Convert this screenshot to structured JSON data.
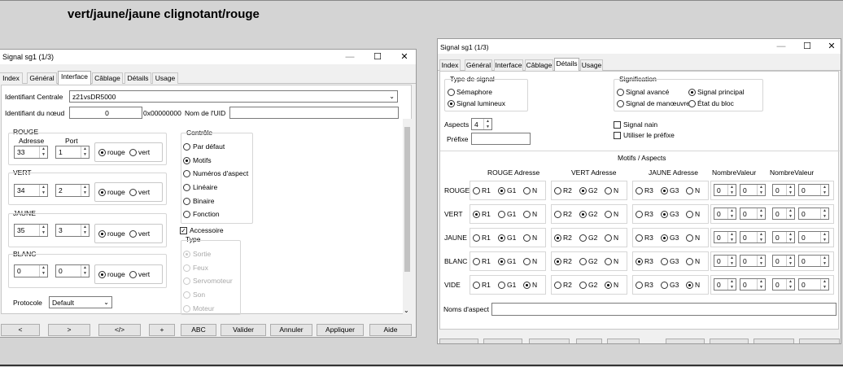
{
  "heading": "vert/jaune/jaune clignotant/rouge",
  "left": {
    "title": "Signal sg1 (1/3)",
    "window_buttons": [
      "—",
      "☐",
      "✕"
    ],
    "tabs": [
      "Index",
      "Général",
      "Interface",
      "Câblage",
      "Détails",
      "Usage"
    ],
    "identifiant_centrale_label": "Identifiant Centrale",
    "identifiant_centrale_value": "z21vsDR5000",
    "identifiant_noeud_label": "Identifiant du nœud",
    "identifiant_noeud_value": "0",
    "hex_value": "0x00000000",
    "uid_label": "Nom de l'UID",
    "adresse_label": "Adresse",
    "port_label": "Port",
    "groups": [
      {
        "name": "ROUGE",
        "adresse": "33",
        "port": "1"
      },
      {
        "name": "VERT",
        "adresse": "34",
        "port": "2"
      },
      {
        "name": "JAUNE",
        "adresse": "35",
        "port": "3"
      },
      {
        "name": "BLANC",
        "adresse": "0",
        "port": "0"
      }
    ],
    "rouge_label": "rouge",
    "vert_label": "vert",
    "controle_label": "Contrôle",
    "controle_options": [
      "Par défaut",
      "Motifs",
      "Numéros d'aspect",
      "Linéaire",
      "Binaire",
      "Fonction"
    ],
    "controle_selected": 1,
    "accessoire_label": "Accessoire",
    "type_label": "Type",
    "type_options": [
      "Sortie",
      "Feux",
      "Servomoteur",
      "Son",
      "Moteur"
    ],
    "protocole_label": "Protocole",
    "protocole_value": "Default",
    "buttons": [
      "<",
      ">",
      "</>",
      "+",
      "ABC",
      "Valider",
      "Annuler",
      "Appliquer",
      "Aide"
    ]
  },
  "right": {
    "title": "Signal sg1 (1/3)",
    "window_buttons": [
      "—",
      "☐",
      "✕"
    ],
    "tabs": [
      "Index",
      "Général",
      "Interface",
      "Câblage",
      "Détails",
      "Usage"
    ],
    "type_signal_label": "Type de signal",
    "semaphore_label": "Sémaphore",
    "signal_lumineux_label": "Signal lumineux",
    "signification_label": "Signification",
    "signal_avance_label": "Signal avancé",
    "signal_principal_label": "Signal principal",
    "signal_manoeuvre_label": "Signal de manœuvre",
    "etat_bloc_label": "État du bloc",
    "aspects_label": "Aspects",
    "aspects_value": "4",
    "prefixe_label": "Préfixe",
    "signal_nain_label": "Signal nain",
    "utiliser_prefixe_label": "Utiliser le préfixe",
    "motifs_label": "Motifs / Aspects",
    "columns": [
      "ROUGE Adresse",
      "VERT Adresse",
      "JAUNE Adresse",
      "NombreValeur",
      "NombreValeur"
    ],
    "rows": [
      {
        "name": "ROUGE",
        "r": 1,
        "v": 1,
        "j": 1
      },
      {
        "name": "VERT",
        "r": 0,
        "v": 1,
        "j": 1
      },
      {
        "name": "JAUNE",
        "r": 1,
        "v": 0,
        "j": 1
      },
      {
        "name": "BLANC",
        "r": 1,
        "v": 0,
        "j": 0
      },
      {
        "name": "VIDE",
        "r": 2,
        "v": 2,
        "j": 2
      }
    ],
    "r_opts": [
      "R1",
      "G1",
      "N"
    ],
    "v_opts": [
      "R2",
      "G2",
      "N"
    ],
    "j_opts": [
      "R3",
      "G3",
      "N"
    ],
    "zero": "0",
    "noms_aspect_label": "Noms d'aspect"
  }
}
